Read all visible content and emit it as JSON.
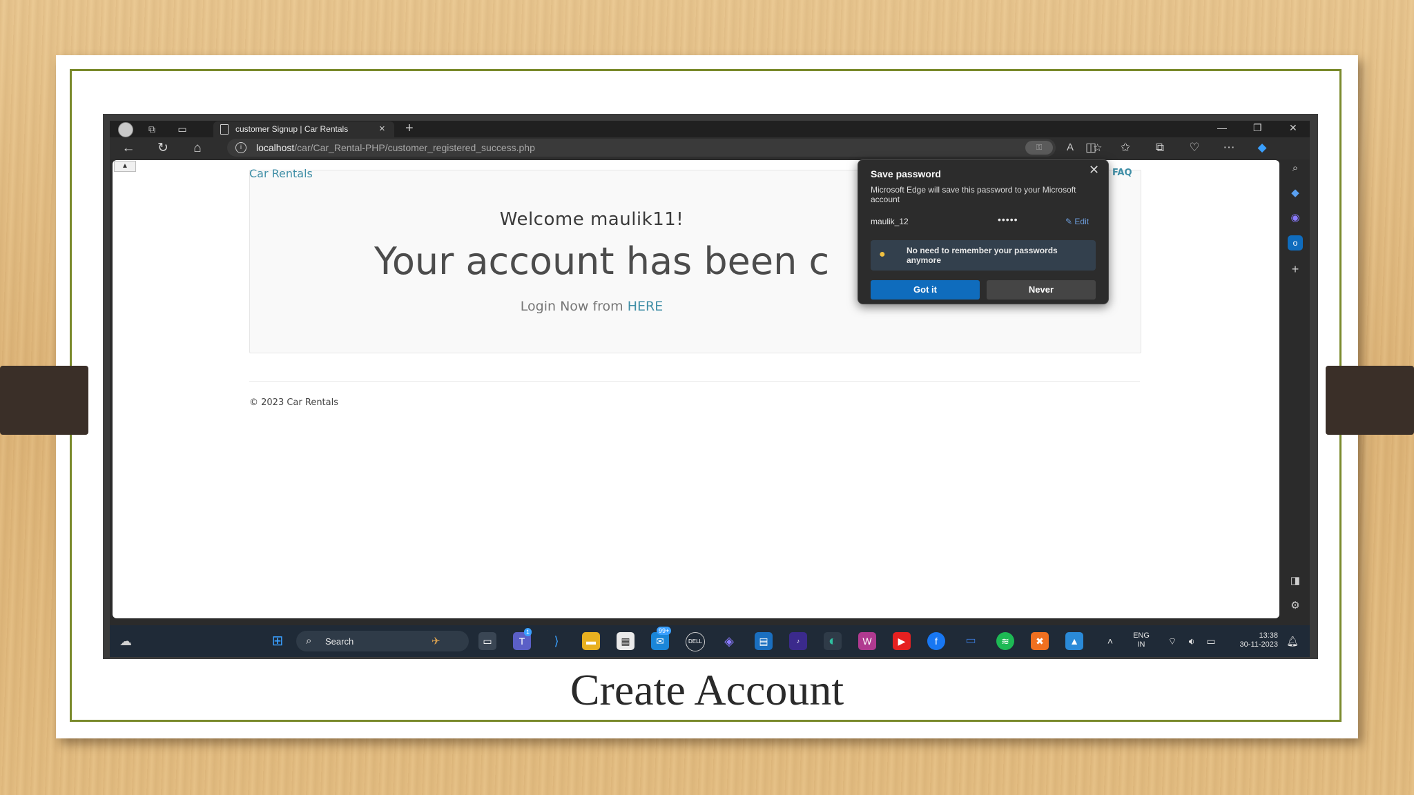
{
  "caption": "Create Account",
  "browser": {
    "tab_title": "customer Signup | Car Rentals",
    "url_host": "localhost",
    "url_path": "/car/Car_Rental-PHP/customer_registered_success.php"
  },
  "page": {
    "brand": "Car Rentals",
    "nav_faq": "FAQ",
    "welcome": "Welcome maulik11!",
    "headline": "Your account has been c",
    "login_prefix": "Login Now from ",
    "login_link": "HERE",
    "footer": "© 2023 Car Rentals"
  },
  "popup": {
    "title": "Save password",
    "description": "Microsoft Edge will save this password to your Microsoft account",
    "username": "maulik_12",
    "password_mask": "•••••",
    "edit_label": "Edit",
    "tip": "No need to remember your passwords anymore",
    "primary_button": "Got it",
    "secondary_button": "Never"
  },
  "taskbar": {
    "search_label": "Search",
    "language": "ENG",
    "region": "IN",
    "time": "13:38",
    "date": "30-11-2023",
    "mail_badge": "99+",
    "teams_badge": "1"
  },
  "icons": {
    "back": "back-arrow-icon",
    "refresh": "refresh-icon",
    "home": "home-icon",
    "info": "info-icon",
    "key": "key-icon",
    "read_aloud": "read-aloud-icon",
    "favorite": "star-icon"
  },
  "colors": {
    "accent_link": "#3f8ea6",
    "edge_blue": "#0f6cbd",
    "slide_border": "#7a8a2c"
  }
}
